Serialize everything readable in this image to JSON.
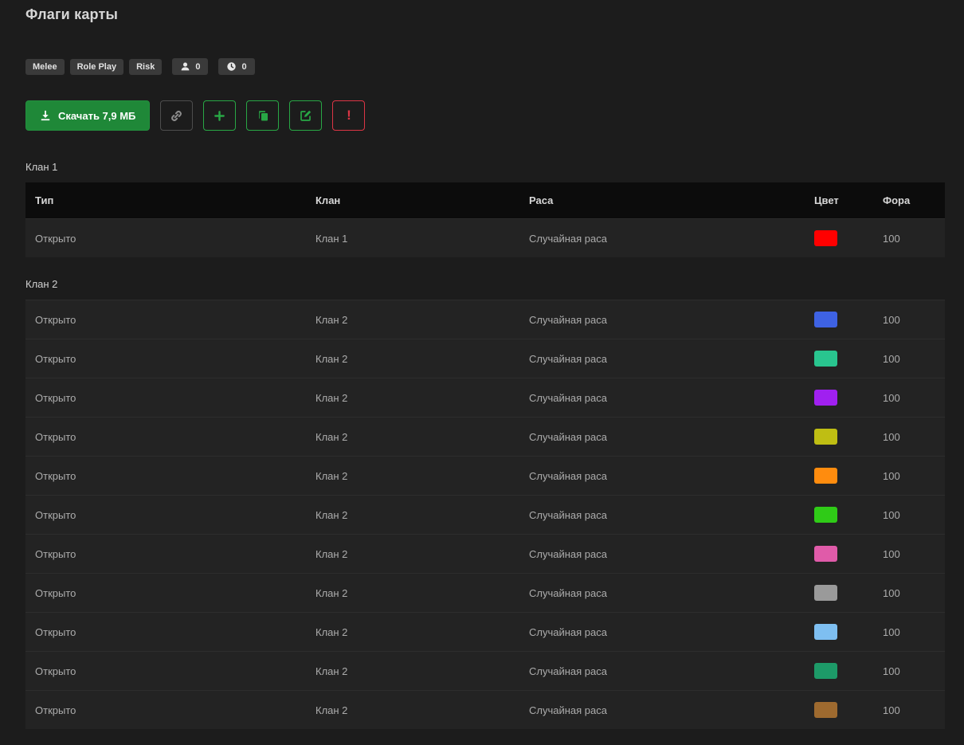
{
  "page": {
    "title": "Флаги карты"
  },
  "badges": [
    {
      "label": "Melee"
    },
    {
      "label": "Role Play"
    },
    {
      "label": "Risk"
    }
  ],
  "counters": [
    {
      "icon": "person-icon",
      "value": "0"
    },
    {
      "icon": "clock-icon",
      "value": "0"
    }
  ],
  "toolbar": {
    "download_label": "Скачать 7,9 МБ",
    "warning_label": "!",
    "buttons": [
      "download-button",
      "link-button",
      "add-button",
      "copy-button",
      "edit-button",
      "warning-button"
    ]
  },
  "colors": {
    "accent_green": "#28a745",
    "danger_red": "#dc3545",
    "download_bg": "#1f8838",
    "page_bg": "#1c1c1c",
    "row_bg": "#232323",
    "header_bg": "#0c0c0c"
  },
  "table": {
    "headers": [
      "Тип",
      "Клан",
      "Раса",
      "Цвет",
      "Фора"
    ],
    "sections": [
      {
        "title": "Клан 1",
        "show_header": true,
        "rows": [
          {
            "type": "Открыто",
            "clan": "Клан 1",
            "race": "Случайная раса",
            "color": "#ff0000",
            "handicap": "100"
          }
        ]
      },
      {
        "title": "Клан 2",
        "show_header": false,
        "rows": [
          {
            "type": "Открыто",
            "clan": "Клан 2",
            "race": "Случайная раса",
            "color": "#3e62e3",
            "handicap": "100"
          },
          {
            "type": "Открыто",
            "clan": "Клан 2",
            "race": "Случайная раса",
            "color": "#29c58f",
            "handicap": "100"
          },
          {
            "type": "Открыто",
            "clan": "Клан 2",
            "race": "Случайная раса",
            "color": "#a020f0",
            "handicap": "100"
          },
          {
            "type": "Открыто",
            "clan": "Клан 2",
            "race": "Случайная раса",
            "color": "#bfbe13",
            "handicap": "100"
          },
          {
            "type": "Открыто",
            "clan": "Клан 2",
            "race": "Случайная раса",
            "color": "#ff8c0e",
            "handicap": "100"
          },
          {
            "type": "Открыто",
            "clan": "Клан 2",
            "race": "Случайная раса",
            "color": "#2fcb17",
            "handicap": "100"
          },
          {
            "type": "Открыто",
            "clan": "Клан 2",
            "race": "Случайная раса",
            "color": "#e05ba9",
            "handicap": "100"
          },
          {
            "type": "Открыто",
            "clan": "Клан 2",
            "race": "Случайная раса",
            "color": "#9a9a9a",
            "handicap": "100"
          },
          {
            "type": "Открыто",
            "clan": "Клан 2",
            "race": "Случайная раса",
            "color": "#7ebff1",
            "handicap": "100"
          },
          {
            "type": "Открыто",
            "clan": "Клан 2",
            "race": "Случайная раса",
            "color": "#1d9a68",
            "handicap": "100"
          },
          {
            "type": "Открыто",
            "clan": "Клан 2",
            "race": "Случайная раса",
            "color": "#9e6a2f",
            "handicap": "100"
          }
        ]
      }
    ]
  }
}
